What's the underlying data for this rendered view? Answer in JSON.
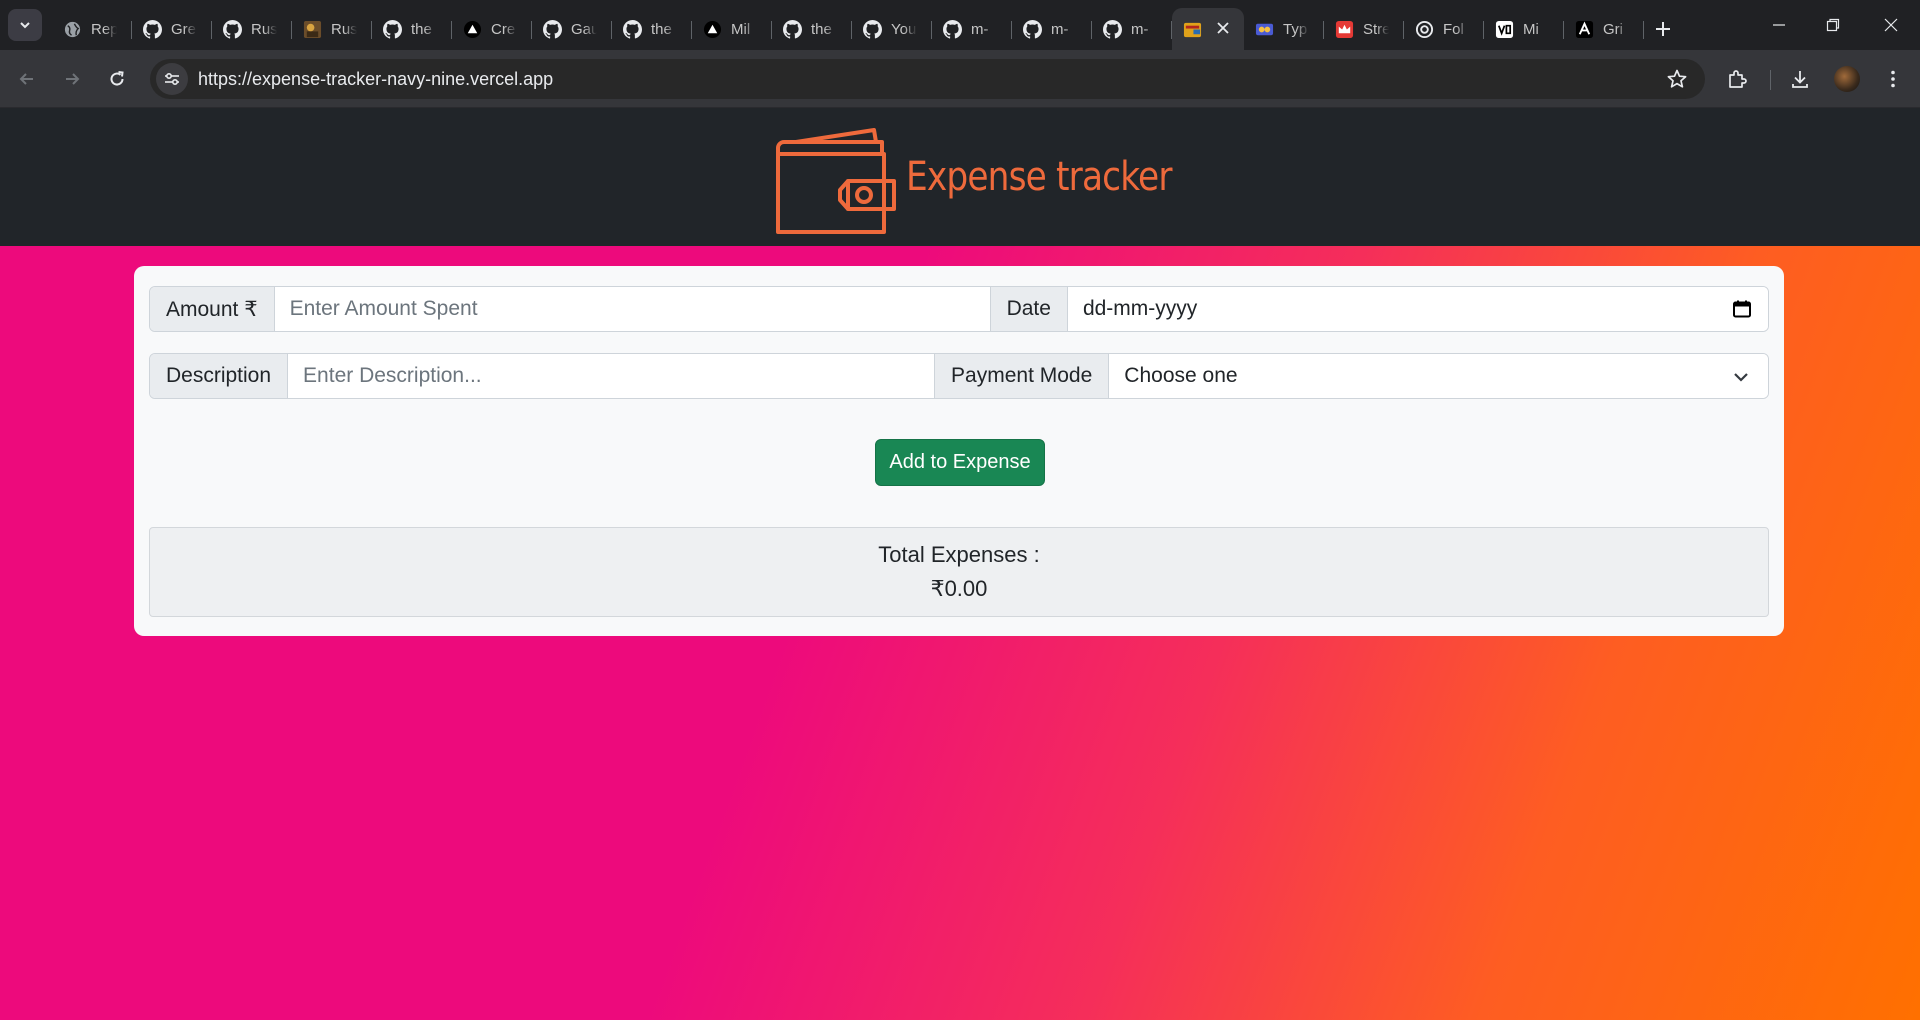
{
  "browser": {
    "tabs": [
      {
        "title": "Rep",
        "icon": "globe-icon"
      },
      {
        "title": "Gre",
        "icon": "github-icon"
      },
      {
        "title": "Rus",
        "icon": "github-icon"
      },
      {
        "title": "Rus",
        "icon": "image-favicon-icon"
      },
      {
        "title": "the",
        "icon": "github-icon"
      },
      {
        "title": "Cre",
        "icon": "triangle-logo-icon"
      },
      {
        "title": "Gau",
        "icon": "github-icon"
      },
      {
        "title": "the",
        "icon": "github-icon"
      },
      {
        "title": "Mil",
        "icon": "triangle-logo-icon"
      },
      {
        "title": "the",
        "icon": "github-icon"
      },
      {
        "title": "You",
        "icon": "github-icon"
      },
      {
        "title": "m-",
        "icon": "github-icon"
      },
      {
        "title": "m-",
        "icon": "github-icon"
      },
      {
        "title": "m-",
        "icon": "github-icon"
      },
      {
        "title": "",
        "icon": "wallet-favicon-icon",
        "active": true
      },
      {
        "title": "Typ",
        "icon": "typing-favicon-icon"
      },
      {
        "title": "Stre",
        "icon": "crown-favicon-icon"
      },
      {
        "title": "Fol",
        "icon": "openai-icon"
      },
      {
        "title": "Mi",
        "icon": "vo-favicon-icon"
      },
      {
        "title": "Gri",
        "icon": "arc-favicon-icon"
      }
    ],
    "url": "https://expense-tracker-navy-nine.vercel.app"
  },
  "app": {
    "brand": "Expense tracker",
    "colors": {
      "brand": "#ee6a3c",
      "header_bg": "#212529",
      "button": "#198754",
      "gradient_start": "#ed0a7c",
      "gradient_end": "#ff7000"
    },
    "form": {
      "amount_label": "Amount ₹",
      "amount_placeholder": "Enter Amount Spent",
      "date_label": "Date",
      "date_value": "dd-mm-yyyy",
      "description_label": "Description",
      "description_placeholder": "Enter Description...",
      "payment_label": "Payment Mode",
      "payment_selected": "Choose one",
      "submit_label": "Add to Expense"
    },
    "total": {
      "label": "Total Expenses :",
      "value": "₹0.00"
    }
  }
}
